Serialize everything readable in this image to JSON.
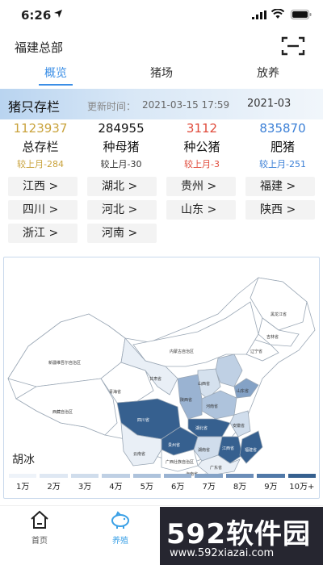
{
  "status_bar": {
    "time": "6:26"
  },
  "header": {
    "title": "福建总部"
  },
  "tabs": [
    {
      "label": "概览",
      "active": true
    },
    {
      "label": "猪场",
      "active": false
    },
    {
      "label": "放养",
      "active": false
    }
  ],
  "section": {
    "title": "猪只存栏",
    "update_label": "更新时间：",
    "update_value": "2021-03-15 17:59",
    "month": "2021-03"
  },
  "stats": [
    {
      "value": "1123937",
      "label": "总存栏",
      "compare": "较上月-284",
      "color": "#c9a23a",
      "compare_color": "#c9a23a"
    },
    {
      "value": "284955",
      "label": "种母猪",
      "compare": "较上月-30",
      "color": "#111111",
      "compare_color": "#333333"
    },
    {
      "value": "3112",
      "label": "种公猪",
      "compare": "较上月-3",
      "color": "#e04a3a",
      "compare_color": "#e04a3a"
    },
    {
      "value": "835870",
      "label": "肥猪",
      "compare": "较上月-251",
      "color": "#3a7fd6",
      "compare_color": "#3a7fd6"
    }
  ],
  "regions": [
    "江西 >",
    "湖北 >",
    "贵州 >",
    "福建 >",
    "四川 >",
    "河北 >",
    "山东 >",
    "陕西 >",
    "浙江 >",
    "河南 >"
  ],
  "map": {
    "caption": "胡冰",
    "provinces": {
      "xinjiang": "新疆维吾尔自治区",
      "xizang": "西藏自治区",
      "qinghai": "青海省",
      "gansu": "甘肃省",
      "neimenggu": "内蒙古自治区",
      "heilongjiang": "黑龙江省",
      "jilin": "吉林省",
      "liaoning": "辽宁省",
      "shanxi": "山西省",
      "shandong": "山东省",
      "henan": "河南省",
      "shaanxi": "陕西省",
      "sichuan": "四川省",
      "hubei": "湖北省",
      "anhui": "安徽省",
      "jiangxi": "江西省",
      "hunan": "湖南省",
      "guizhou": "贵州省",
      "yunnan": "云南省",
      "guangxi": "广西壮族自治区",
      "guangdong": "广东省",
      "fujian": "福建省",
      "hainan": "海南省"
    },
    "legend": [
      "1万",
      "2万",
      "3万",
      "4万",
      "5万",
      "6万",
      "7万",
      "8万",
      "9万",
      "10万+"
    ]
  },
  "bottom_nav": [
    {
      "label": "首页",
      "active": false
    },
    {
      "label": "养殖",
      "active": true
    }
  ],
  "watermark": {
    "logo": "592软件园",
    "url": "www.592xiazai.com"
  }
}
